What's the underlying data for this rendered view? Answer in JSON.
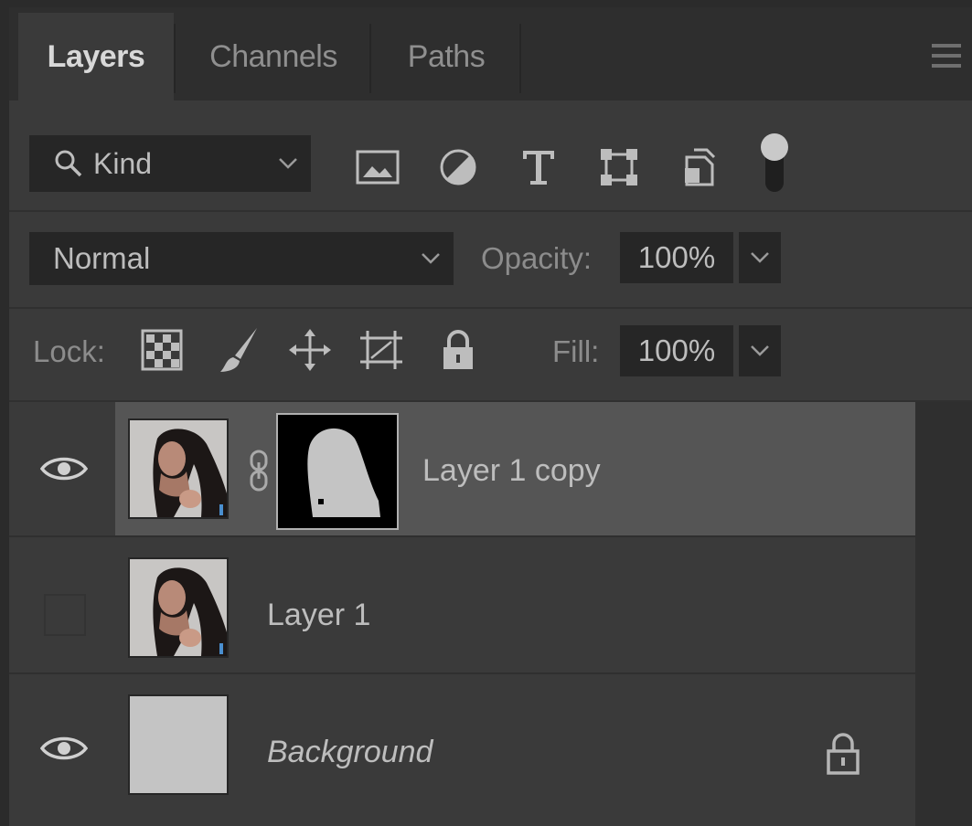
{
  "tabs": [
    {
      "label": "Layers",
      "active": true
    },
    {
      "label": "Channels",
      "active": false
    },
    {
      "label": "Paths",
      "active": false
    }
  ],
  "panel_menu_icon": "hamburger-icon",
  "filter": {
    "kind_label": "Kind",
    "icons": [
      "image-filter-icon",
      "adjustment-filter-icon",
      "type-filter-icon",
      "shape-filter-icon",
      "smart-object-filter-icon"
    ],
    "toggle_state": "on"
  },
  "blend": {
    "mode": "Normal",
    "opacity_label": "Opacity:",
    "opacity_value": "100%"
  },
  "lock": {
    "label": "Lock:",
    "icons": [
      "lock-transparent-pixels-icon",
      "lock-image-pixels-icon",
      "lock-position-icon",
      "lock-artboard-icon",
      "lock-all-icon"
    ],
    "fill_label": "Fill:",
    "fill_value": "100%"
  },
  "layers": [
    {
      "name": "Layer 1 copy",
      "visible": true,
      "selected": true,
      "has_mask": true,
      "linked_mask": true,
      "thumbnail": "portrait-photo"
    },
    {
      "name": "Layer 1",
      "visible": false,
      "selected": false,
      "has_mask": false,
      "thumbnail": "portrait-photo"
    },
    {
      "name": "Background",
      "visible": true,
      "selected": false,
      "locked": true,
      "italic": true,
      "thumbnail": "solid-gray"
    }
  ],
  "colors": {
    "panel_bg": "#3a3a3a",
    "tabbar_bg": "#2e2e2e",
    "field_bg": "#262626",
    "selected_row": "#555555",
    "text": "#bdbdbd"
  }
}
